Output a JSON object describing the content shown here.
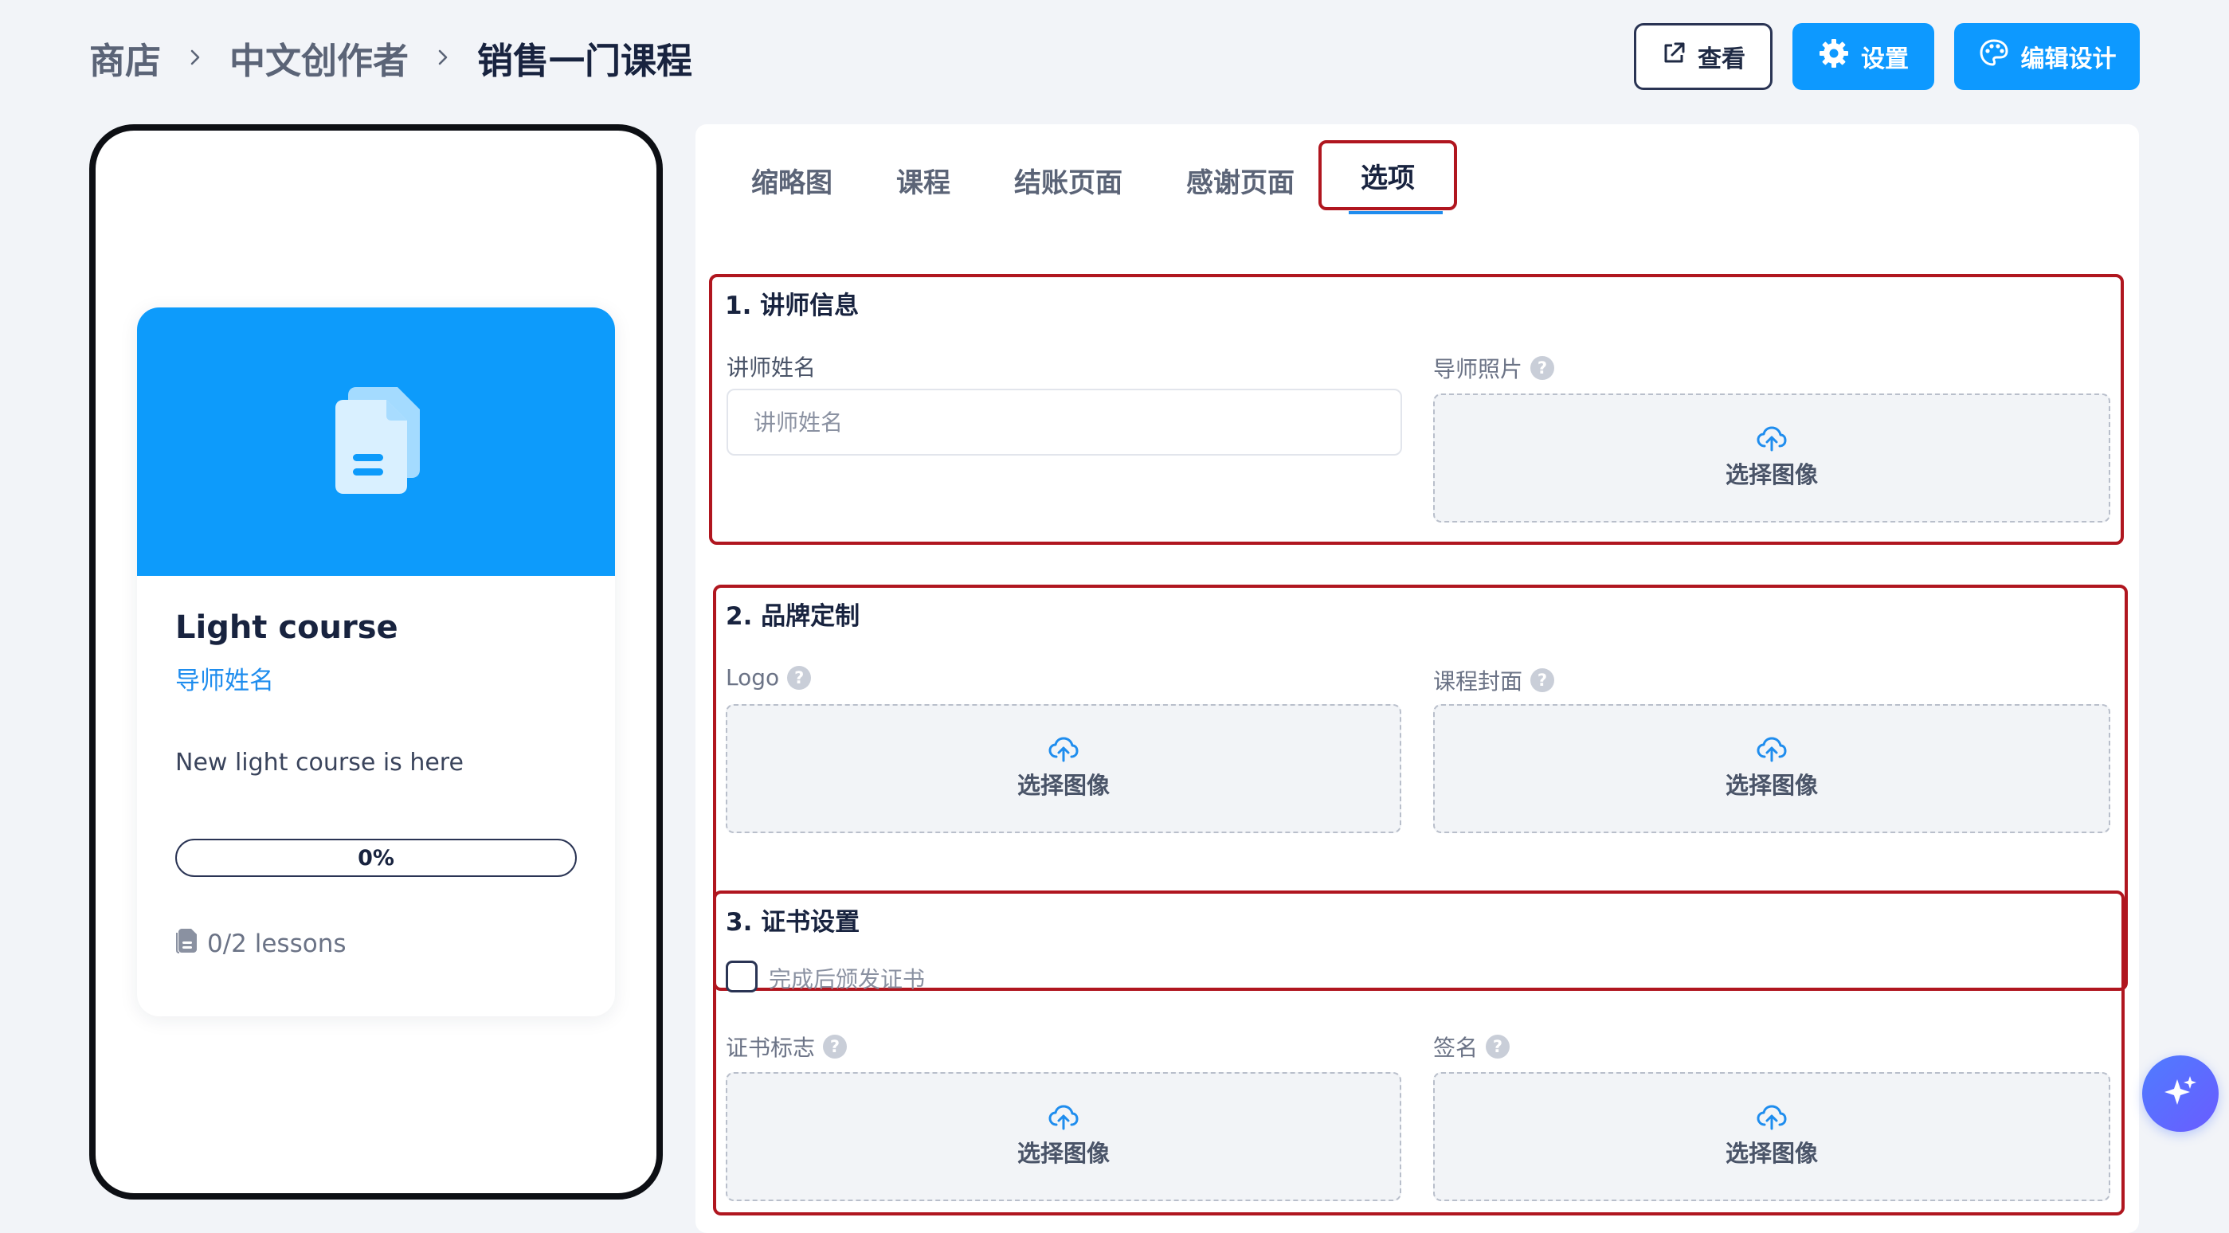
{
  "breadcrumb": {
    "items": [
      "商店",
      "中文创作者",
      "销售一门课程"
    ]
  },
  "actions": {
    "view_label": "查看",
    "settings_label": "设置",
    "design_label": "编辑设计"
  },
  "preview": {
    "title": "Light course",
    "instructor": "导师姓名",
    "description": "New light course is here",
    "progress_text": "0%",
    "progress_value": 0,
    "lessons": "0/2 lessons"
  },
  "tabs": [
    {
      "label": "缩略图",
      "active": false
    },
    {
      "label": "课程",
      "active": false
    },
    {
      "label": "结账页面",
      "active": false
    },
    {
      "label": "感谢页面",
      "active": false
    },
    {
      "label": "选项",
      "active": true
    }
  ],
  "sections": {
    "instructor": {
      "title": "1. 讲师信息",
      "name_label": "讲师姓名",
      "name_placeholder": "讲师姓名",
      "name_value": "",
      "photo_label": "导师照片",
      "photo_button": "选择图像"
    },
    "branding": {
      "title": "2. 品牌定制",
      "logo_label": "Logo",
      "logo_button": "选择图像",
      "cover_label": "课程封面",
      "cover_button": "选择图像"
    },
    "certificate": {
      "title": "3. 证书设置",
      "checkbox_label": "完成后颁发证书",
      "checkbox_checked": false,
      "logo_label": "证书标志",
      "logo_button": "选择图像",
      "signature_label": "签名",
      "signature_button": "选择图像"
    }
  },
  "help_glyph": "?",
  "colors": {
    "accent": "#0d99ff",
    "highlight_border": "#b0161f",
    "cover_bg": "#0d9bfb",
    "link": "#1f8dee"
  }
}
